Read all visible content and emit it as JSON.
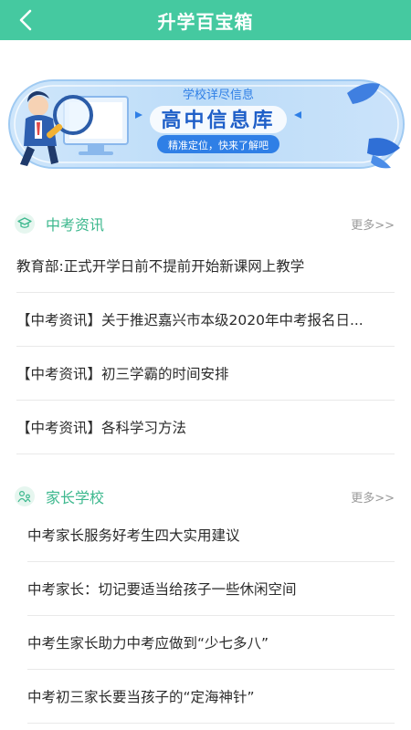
{
  "header": {
    "title": "升学百宝箱"
  },
  "banner": {
    "subtitle": "学校详尽信息",
    "main_title": "高中信息库",
    "slogan": "精准定位，快来了解吧"
  },
  "sections": [
    {
      "title": "中考资讯",
      "more": "更多>>",
      "items": [
        "教育部:正式开学日前不提前开始新课网上教学",
        "【中考资讯】关于推迟嘉兴市本级2020年中考报名日...",
        "【中考资讯】初三学霸的时间安排",
        "【中考资讯】各科学习方法"
      ]
    },
    {
      "title": "家长学校",
      "more": "更多>>",
      "items": [
        "中考家长服务好考生四大实用建议",
        "中考家长：切记要适当给孩子一些休闲空间",
        "中考生家长助力中考应做到“少七多八”",
        "中考初三家长要当孩子的“定海神针”"
      ]
    }
  ]
}
